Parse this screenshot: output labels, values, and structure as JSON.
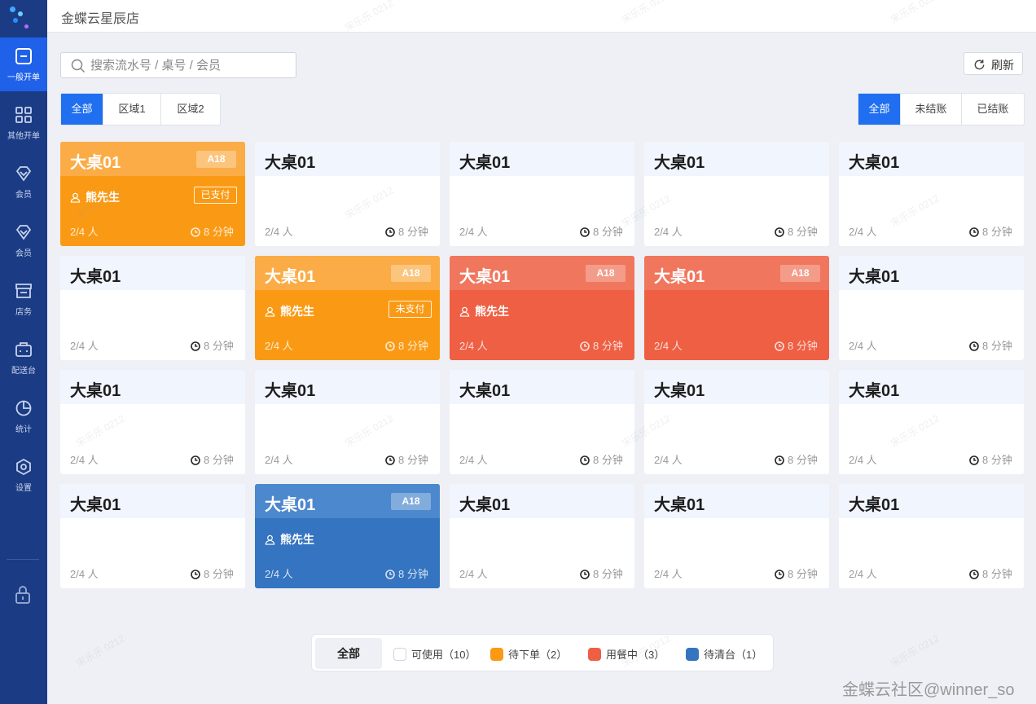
{
  "header": {
    "store_name": "金蝶云星辰店"
  },
  "sidebar": {
    "items": [
      {
        "label": "一般开单",
        "icon": "order-icon",
        "active": true
      },
      {
        "label": "其他开单",
        "icon": "grid-icon",
        "active": false
      },
      {
        "label": "会员",
        "icon": "member-icon",
        "active": false
      },
      {
        "label": "会员",
        "icon": "member-icon",
        "active": false
      },
      {
        "label": "店务",
        "icon": "store-icon",
        "active": false
      },
      {
        "label": "配送台",
        "icon": "delivery-icon",
        "active": false
      },
      {
        "label": "统计",
        "icon": "chart-icon",
        "active": false
      },
      {
        "label": "设置",
        "icon": "settings-icon",
        "active": false
      }
    ],
    "bottom_icon": "lock-icon"
  },
  "search": {
    "placeholder": "搜索流水号 / 桌号 / 会员",
    "value": ""
  },
  "refresh_label": "刷新",
  "area_tabs": [
    {
      "label": "全部",
      "active": true
    },
    {
      "label": "区域1",
      "active": false
    },
    {
      "label": "区域2",
      "active": false
    }
  ],
  "status_tabs": [
    {
      "label": "全部",
      "active": true
    },
    {
      "label": "未结账",
      "active": false
    },
    {
      "label": "已结账",
      "active": false
    }
  ],
  "tables": [
    {
      "name": "大桌01",
      "state": "orange",
      "code": "A18",
      "guest": "熊先生",
      "pay": "已支付",
      "capacity": "2/4 人",
      "time": "8 分钟"
    },
    {
      "name": "大桌01",
      "state": "idle",
      "capacity": "2/4 人",
      "time": "8 分钟"
    },
    {
      "name": "大桌01",
      "state": "idle",
      "capacity": "2/4 人",
      "time": "8 分钟"
    },
    {
      "name": "大桌01",
      "state": "idle",
      "capacity": "2/4 人",
      "time": "8 分钟"
    },
    {
      "name": "大桌01",
      "state": "idle",
      "capacity": "2/4 人",
      "time": "8 分钟"
    },
    {
      "name": "大桌01",
      "state": "idle",
      "capacity": "2/4 人",
      "time": "8 分钟"
    },
    {
      "name": "大桌01",
      "state": "orange",
      "code": "A18",
      "guest": "熊先生",
      "pay": "未支付",
      "capacity": "2/4 人",
      "time": "8 分钟"
    },
    {
      "name": "大桌01",
      "state": "red",
      "code": "A18",
      "guest": "熊先生",
      "capacity": "2/4 人",
      "time": "8 分钟"
    },
    {
      "name": "大桌01",
      "state": "red",
      "code": "A18",
      "capacity": "2/4 人",
      "time": "8 分钟"
    },
    {
      "name": "大桌01",
      "state": "idle",
      "capacity": "2/4 人",
      "time": "8 分钟"
    },
    {
      "name": "大桌01",
      "state": "idle",
      "capacity": "2/4 人",
      "time": "8 分钟"
    },
    {
      "name": "大桌01",
      "state": "idle",
      "capacity": "2/4 人",
      "time": "8 分钟"
    },
    {
      "name": "大桌01",
      "state": "idle",
      "capacity": "2/4 人",
      "time": "8 分钟"
    },
    {
      "name": "大桌01",
      "state": "idle",
      "capacity": "2/4 人",
      "time": "8 分钟"
    },
    {
      "name": "大桌01",
      "state": "idle",
      "capacity": "2/4 人",
      "time": "8 分钟"
    },
    {
      "name": "大桌01",
      "state": "idle",
      "capacity": "2/4 人",
      "time": "8 分钟"
    },
    {
      "name": "大桌01",
      "state": "blue",
      "code": "A18",
      "guest": "熊先生",
      "capacity": "2/4 人",
      "time": "8 分钟"
    },
    {
      "name": "大桌01",
      "state": "idle",
      "capacity": "2/4 人",
      "time": "8 分钟"
    },
    {
      "name": "大桌01",
      "state": "idle",
      "capacity": "2/4 人",
      "time": "8 分钟"
    },
    {
      "name": "大桌01",
      "state": "idle",
      "capacity": "2/4 人",
      "time": "8 分钟"
    }
  ],
  "legend": {
    "all_label": "全部",
    "items": [
      {
        "label": "可使用（10）",
        "color": "#ffffff"
      },
      {
        "label": "待下单（2）",
        "color": "#fa9a14"
      },
      {
        "label": "用餐中（3）",
        "color": "#ee5f43"
      },
      {
        "label": "待清台（1）",
        "color": "#3474c0"
      }
    ]
  },
  "watermark_text": "宋乐乐 0212",
  "footer_watermark": "金蝶云社区@winner_so",
  "colors": {
    "sidebar": "#1b3c84",
    "accent": "#1f6ff0",
    "orange": "#fa9a14",
    "red": "#ee5f43",
    "blue": "#3474c0"
  }
}
